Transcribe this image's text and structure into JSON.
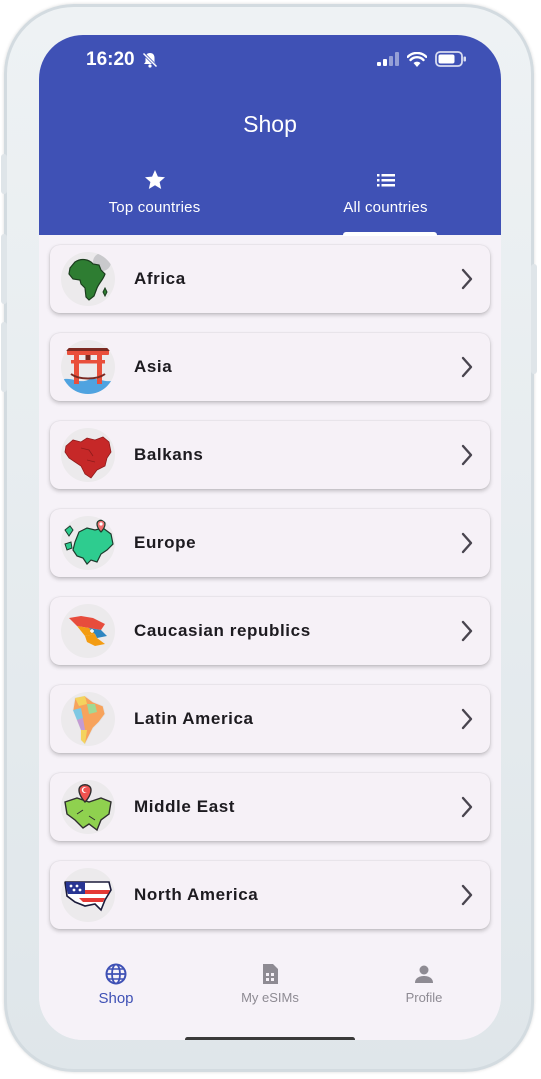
{
  "status_bar": {
    "time": "16:20",
    "icons": [
      "bell-off-icon",
      "signal-icon",
      "wifi-icon",
      "battery-icon"
    ]
  },
  "header": {
    "title": "Shop",
    "background_color": "#3f51b5"
  },
  "tabs": [
    {
      "label": "Top countries",
      "icon": "star-icon",
      "selected": false
    },
    {
      "label": "All countries",
      "icon": "list-icon",
      "selected": true
    }
  ],
  "regions": [
    {
      "label": "Africa",
      "icon": "africa-map-icon"
    },
    {
      "label": "Asia",
      "icon": "torii-gate-icon"
    },
    {
      "label": "Balkans",
      "icon": "balkans-map-icon"
    },
    {
      "label": "Europe",
      "icon": "europe-map-icon"
    },
    {
      "label": "Caucasian republics",
      "icon": "caucasus-map-icon"
    },
    {
      "label": "Latin America",
      "icon": "latin-america-map-icon"
    },
    {
      "label": "Middle East",
      "icon": "middle-east-map-icon"
    },
    {
      "label": "North America",
      "icon": "north-america-map-icon"
    }
  ],
  "bottom_nav": [
    {
      "label": "Shop",
      "icon": "globe-icon",
      "active": true
    },
    {
      "label": "My eSIMs",
      "icon": "sim-card-icon",
      "active": false
    },
    {
      "label": "Profile",
      "icon": "person-icon",
      "active": false
    }
  ],
  "colors": {
    "accent": "#3f51b5",
    "card_background": "#f6f1f7",
    "screen_background": "#f6f2f8"
  }
}
